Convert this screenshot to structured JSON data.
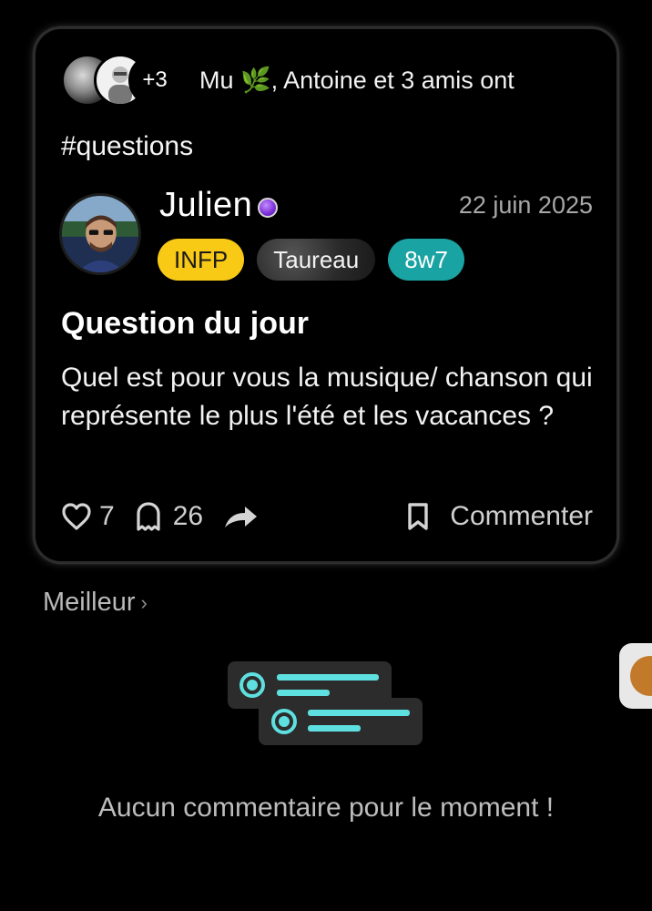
{
  "post": {
    "friends": {
      "extra_count": "+3",
      "text_prefix": "Mu ",
      "leaf": "🌿",
      "text_suffix": ", Antoine et 3 amis ont"
    },
    "hashtag": "#questions",
    "author": {
      "name": "Julien",
      "date": "22 juin 2025",
      "badges": {
        "mbti": "INFP",
        "zodiac": "Taureau",
        "score": "8w7"
      }
    },
    "title": "Question du jour",
    "body": "Quel est pour vous la musique/ chanson qui représente le plus l'été et les vacances ?",
    "actions": {
      "likes": "7",
      "comments": "26",
      "comment_label": "Commenter"
    }
  },
  "comments": {
    "sort_label": "Meilleur",
    "empty_text": "Aucun commentaire pour le moment !"
  },
  "colors": {
    "mbti_badge": "#f8ca16",
    "score_badge": "#1aa3a3",
    "accent_teal": "#5fe0e0",
    "verified": "#7a2fd6"
  },
  "icons": {
    "like": "heart-icon",
    "comments": "ghost-icon",
    "share": "share-arrow-icon",
    "save": "bookmark-icon",
    "sort": "chevron-right-icon",
    "verified": "verified-dot-icon"
  }
}
